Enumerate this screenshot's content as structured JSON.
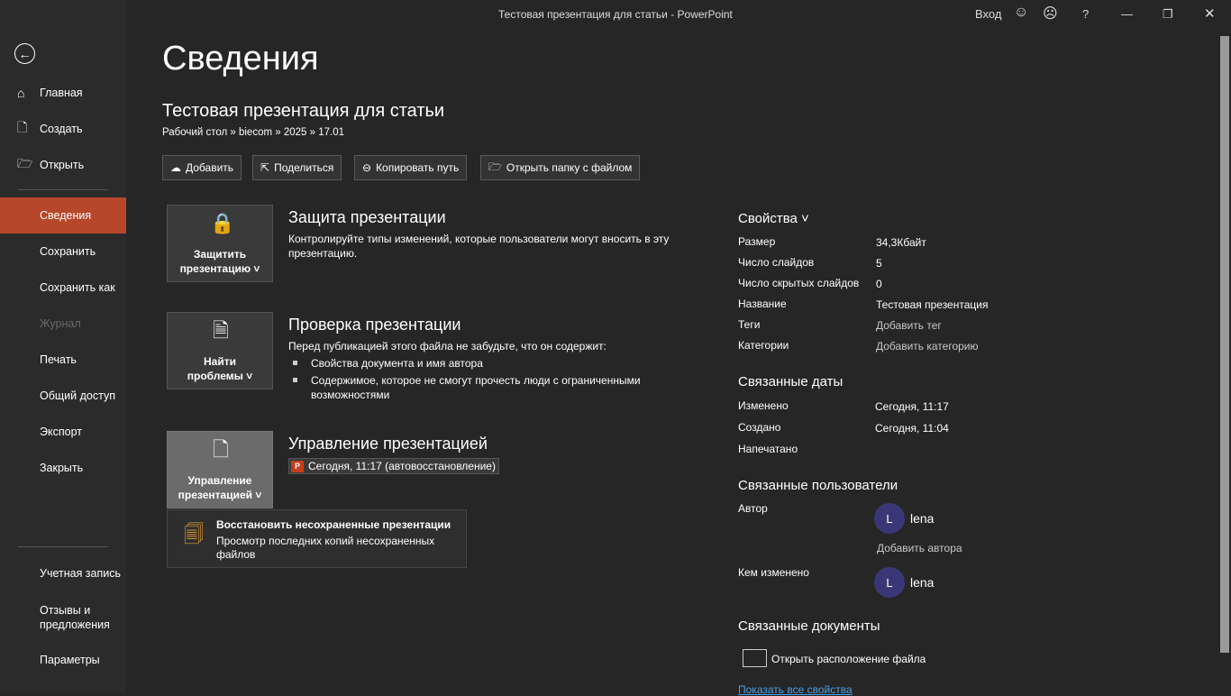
{
  "window": {
    "title": "Тестовая презентация для статьи  -  PowerPoint",
    "signin": "Вход",
    "help": "?"
  },
  "sidebar": {
    "items": [
      "Главная",
      "Создать",
      "Открыть",
      "Сведения",
      "Сохранить",
      "Сохранить как",
      "Журнал",
      "Печать",
      "Общий доступ",
      "Экспорт",
      "Закрыть"
    ],
    "bottom": [
      "Учетная запись",
      "Отзывы и предложения",
      "Параметры"
    ]
  },
  "page": {
    "heading": "Сведения",
    "doc_title": "Тестовая презентация для статьи",
    "path": "Рабочий стол » biecom » 2025 » 17.01"
  },
  "actions": [
    "Добавить",
    "Поделиться",
    "Копировать путь",
    "Открыть папку с файлом"
  ],
  "sections": {
    "protect": {
      "button": [
        "Защитить",
        "презентацию ˅"
      ],
      "title": "Защита презентации",
      "text": "Контролируйте типы изменений, которые пользователи могут вносить в эту презентацию."
    },
    "inspect": {
      "button": [
        "Найти",
        "проблемы ˅"
      ],
      "title": "Проверка презентации",
      "text": "Перед публикацией этого файла не забудьте, что он содержит:",
      "bullets": [
        "Свойства документа и имя автора",
        "Содержимое, которое не смогут прочесть люди с ограниченными возможностями"
      ]
    },
    "manage": {
      "button": [
        "Управление",
        "презентацией ˅"
      ],
      "title": "Управление презентацией",
      "version": "Сегодня, 11:17 (автовосстановление)",
      "menu_title": "Восстановить несохраненные презентации",
      "menu_desc": "Просмотр последних копий несохраненных файлов"
    }
  },
  "properties": {
    "heading": "Свойства ˅",
    "rows": [
      [
        "Размер",
        "34,3Кбайт"
      ],
      [
        "Число слайдов",
        "5"
      ],
      [
        "Число скрытых слайдов",
        "0"
      ],
      [
        "Название",
        "Тестовая презентация"
      ],
      [
        "Теги",
        "Добавить тег"
      ],
      [
        "Категории",
        "Добавить категорию"
      ]
    ]
  },
  "dates": {
    "heading": "Связанные даты",
    "rows": [
      [
        "Изменено",
        "Сегодня, 11:17"
      ],
      [
        "Создано",
        "Сегодня, 11:04"
      ],
      [
        "Напечатано",
        ""
      ]
    ]
  },
  "people": {
    "heading": "Связанные пользователи",
    "author_label": "Автор",
    "author": "lena",
    "initial": "L",
    "add_author": "Добавить автора",
    "modified_label": "Кем изменено",
    "modified_by": "lena"
  },
  "docs": {
    "heading": "Связанные документы",
    "open_location": "Открыть расположение файла",
    "show_all": "Показать все свойства"
  }
}
